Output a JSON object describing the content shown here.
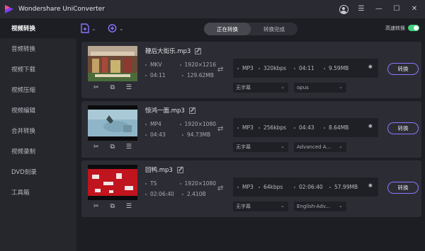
{
  "app": {
    "title": "Wondershare UniConverter"
  },
  "window": {
    "minimize": "—",
    "maximize": "☐",
    "close": "✕",
    "menu": "☰"
  },
  "sidebar": {
    "items": [
      {
        "label": "视频转换",
        "active": true
      },
      {
        "label": "音频转换"
      },
      {
        "label": "视频下载"
      },
      {
        "label": "视频压缩"
      },
      {
        "label": "视频编辑"
      },
      {
        "label": "合并转换"
      },
      {
        "label": "视频录制"
      },
      {
        "label": "DVD刻录"
      },
      {
        "label": "工具箱"
      }
    ]
  },
  "toolbar": {
    "tabs": [
      {
        "label": "正在转换",
        "active": true
      },
      {
        "label": "转换完成"
      }
    ],
    "fast_convert_label": "高速转换",
    "fast_convert_on": true,
    "add_file_chevron": "⌄",
    "add_media_chevron": "⌄"
  },
  "files": [
    {
      "name": "鞭后大街乐.mp3",
      "src_format": "MKV",
      "src_resolution": "1920×1216",
      "src_duration": "04:11",
      "src_size": "129.62MB",
      "dst_format": "MP3",
      "dst_bitrate": "320kbps",
      "dst_duration": "04:11",
      "dst_size": "9.59MB",
      "subtitle": "无字幕",
      "audio": "opus",
      "convert_label": "转换"
    },
    {
      "name": "惊鸿一面.mp3",
      "src_format": "MP4",
      "src_resolution": "1920×1080",
      "src_duration": "04:43",
      "src_size": "94.73MB",
      "dst_format": "MP3",
      "dst_bitrate": "256kbps",
      "dst_duration": "04:43",
      "dst_size": "8.64MB",
      "subtitle": "无字幕",
      "audio": "Advanced A...",
      "convert_label": "转换"
    },
    {
      "name": "回鸭.mp3",
      "src_format": "TS",
      "src_resolution": "1920×1080",
      "src_duration": "02:06:40",
      "src_size": "2.410B",
      "dst_format": "MP3",
      "dst_bitrate": "64kbps",
      "dst_duration": "02:06:40",
      "dst_size": "57.99MB",
      "subtitle": "无字幕",
      "audio": "English-Adv...",
      "convert_label": "转换"
    }
  ],
  "icons": {
    "cut": "✂",
    "crop": "⧉",
    "effects": "☰",
    "shuffle": "⇄",
    "gear": "✱",
    "chevron": "⌄"
  },
  "colors": {
    "accent": "#8b74ff",
    "toggle_on": "#3fd27a"
  }
}
